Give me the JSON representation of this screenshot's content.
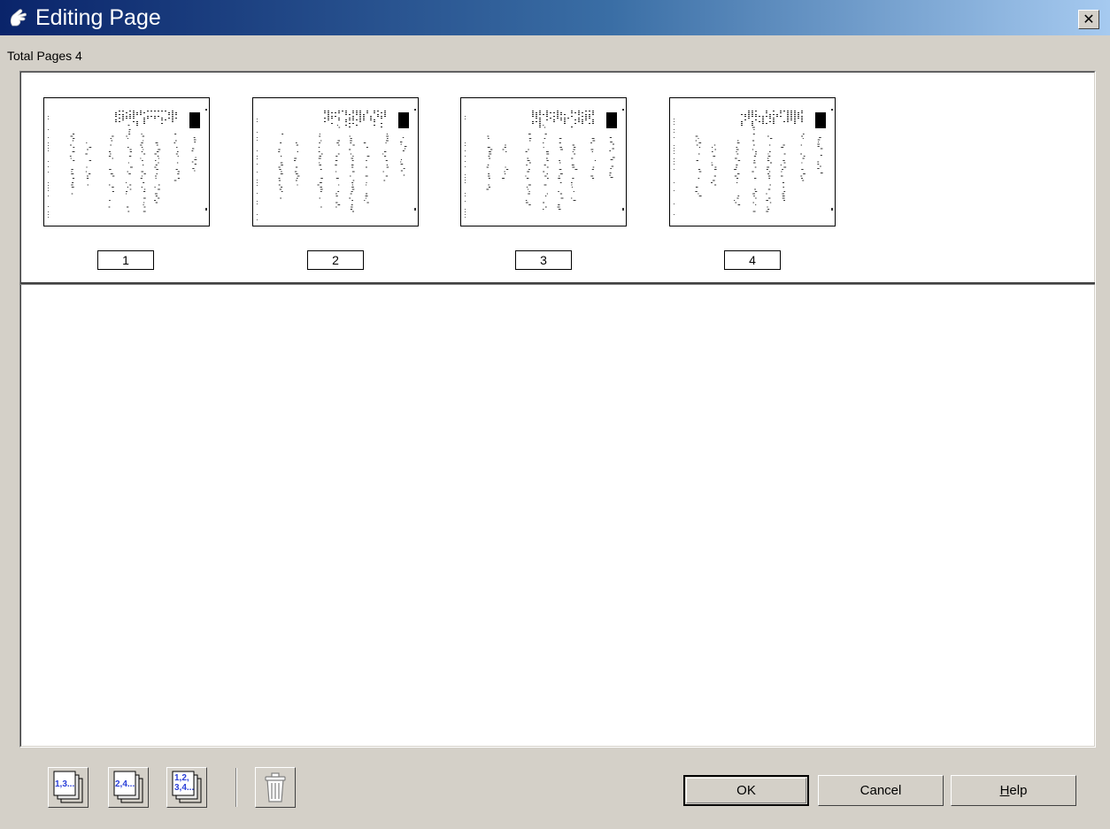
{
  "window": {
    "title": "Editing Page",
    "close_glyph": "✕",
    "title_icon": "hand-icon"
  },
  "total_pages_label": "Total Pages 4",
  "pages": [
    {
      "number": "1"
    },
    {
      "number": "2"
    },
    {
      "number": "3"
    },
    {
      "number": "4"
    }
  ],
  "toolbar": {
    "odd_pages_icon": "odd-pages-icon",
    "odd_pages_text": "1,3...",
    "even_pages_icon": "even-pages-icon",
    "even_pages_text": "2,4...",
    "all_pages_icon": "all-pages-icon",
    "all_pages_text_line1": "1,2,",
    "all_pages_text_line2": "3,4...",
    "delete_icon": "trash-icon"
  },
  "buttons": {
    "ok": "OK",
    "cancel": "Cancel",
    "help_mnemonic": "H",
    "help_rest": "elp"
  },
  "colors": {
    "titlebar_start": "#0a246a",
    "titlebar_end": "#a6caf0",
    "dialog_bg": "#d4d0c8",
    "icon_blue": "#2a3fd8"
  }
}
